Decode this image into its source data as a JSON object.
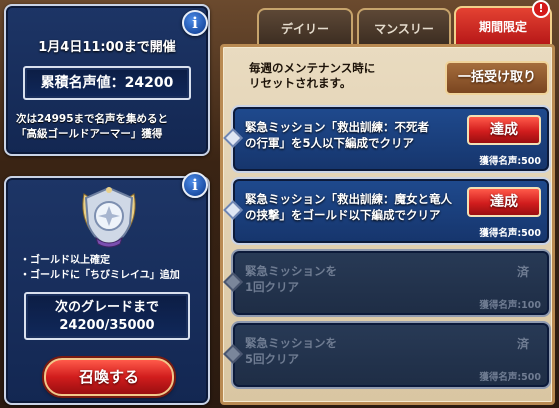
{
  "event": {
    "deadline": "1月4日11:00まで開催",
    "fame_total": "累積名声値：24200",
    "note_line1": "次は24995まで名声を集めると",
    "note_line2": "「高級ゴールドアーマー」獲得"
  },
  "grade": {
    "bonus_1": "・ゴールド以上確定",
    "bonus_2": "・ゴールドに「ちびミレイユ」追加",
    "next_label": "次のグレードまで",
    "next_value": "24200/35000",
    "summon_label": "召喚する"
  },
  "info_icon": "i",
  "tabs": {
    "daily": "デイリー",
    "monthly": "マンスリー",
    "limited": "期間限定",
    "alert": "!"
  },
  "missions": {
    "reset_line1": "毎週のメンテナンス時に",
    "reset_line2": "リセットされます。",
    "claim_all_label": "一括受け取り",
    "items": [
      {
        "title_line1": "緊急ミッション「救出訓練：不死者",
        "title_line2": "の行軍」を5人以下編成でクリア",
        "status": "達成",
        "reward": "獲得名声:500"
      },
      {
        "title_line1": "緊急ミッション「救出訓練：魔女と竜人",
        "title_line2": "の挟撃」をゴールド以下編成でクリア",
        "status": "達成",
        "reward": "獲得名声:500"
      },
      {
        "title_line1": "緊急ミッションを",
        "title_line2": "1回クリア",
        "status": "済",
        "reward": "獲得名声:100"
      },
      {
        "title_line1": "緊急ミッションを",
        "title_line2": "5回クリア",
        "status": "済",
        "reward": "獲得名声:500"
      }
    ]
  },
  "colors": {
    "panel_blue": "#1d3566",
    "accent_red": "#d11d1d",
    "parchment": "#e9dbc0",
    "tab_brown": "#5d4836"
  }
}
